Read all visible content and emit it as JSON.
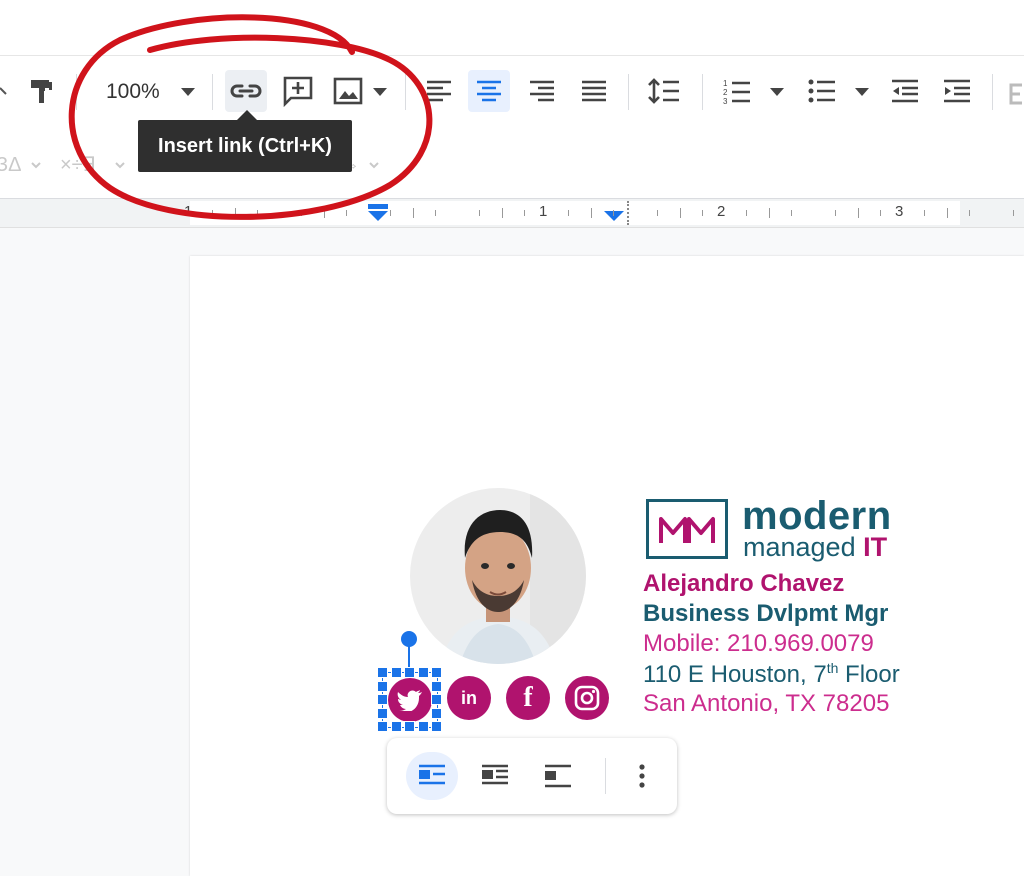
{
  "toolbar": {
    "zoom": "100%",
    "tooltip": "Insert link (Ctrl+K)"
  },
  "ruler": {
    "labels": [
      "1",
      "1",
      "2",
      "3"
    ]
  },
  "signature": {
    "logo_word1": "modern",
    "logo_word2": "managed",
    "logo_word3": "IT",
    "logo_monogram": "MM",
    "name": "Alejandro Chavez",
    "title": "Business Dvlpmt Mgr",
    "mobile": "Mobile: 210.969.0079",
    "address_pre": "110 E Houston, 7",
    "address_sup": "th",
    "address_post": " Floor",
    "city": "San Antonio, TX 78205",
    "social": {
      "linkedin": "in",
      "facebook": "f"
    }
  },
  "colors": {
    "accent": "#1a73e8",
    "brand_magenta": "#b0136e",
    "brand_teal": "#1a5c70",
    "annotation_red": "#d0131b"
  }
}
